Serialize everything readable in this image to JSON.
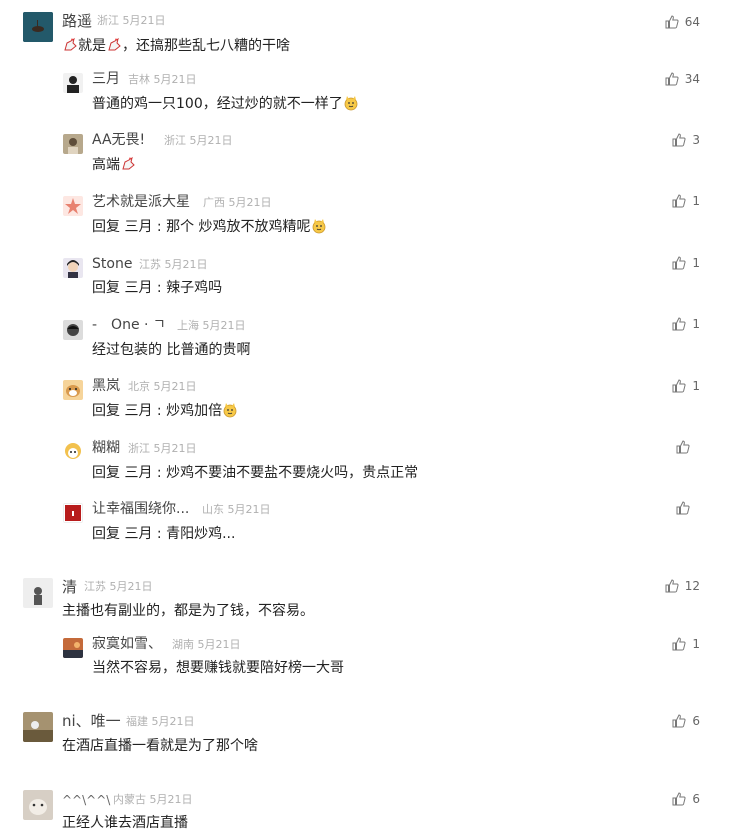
{
  "thread": [
    {
      "user": "路遥",
      "location": "浙江",
      "date": "5月21日",
      "likes": "64",
      "avatar_color": "#1f4e5a",
      "text_parts": [
        "",
        "就是",
        "，还搞那些乱七八糟的干啥"
      ],
      "emoji": [
        "rooster-emoji",
        "rooster-emoji"
      ]
    },
    {
      "user": "三月",
      "location": "吉林",
      "date": "5月21日",
      "likes": "34",
      "avatar_color": "#2b2b2b",
      "text": "普通的鸡一只100，经过炒的就不一样了",
      "emoji_after": "cat-emoji"
    },
    {
      "user": "AA无畏!",
      "location": "浙江",
      "date": "5月21日",
      "likes": "3",
      "avatar_color": "#8d7a60",
      "text": "高端",
      "emoji_after": "rooster-emoji"
    },
    {
      "user": "艺术就是派大星",
      "location": "广西",
      "date": "5月21日",
      "likes": "1",
      "avatar_color": "#e8816f",
      "reply_prefix": "回复 三月 :",
      "text": " 那个 炒鸡放不放鸡精呢",
      "emoji_after": "cat-emoji"
    },
    {
      "user": "Stone",
      "location": "江苏",
      "date": "5月21日",
      "likes": "1",
      "avatar_color": "#333344",
      "reply_prefix": "回复 三月 :",
      "text": " 辣子鸡吗"
    },
    {
      "user": "-　One · ㄱ",
      "location": "上海",
      "date": "5月21日",
      "likes": "1",
      "avatar_color": "#5a5a5a",
      "text": "经过包装的 比普通的贵啊"
    },
    {
      "user": "黑岚",
      "location": "北京",
      "date": "5月21日",
      "likes": "1",
      "avatar_color": "#d99a4e",
      "reply_prefix": "回复 三月 :",
      "text": " 炒鸡加倍",
      "emoji_after": "cat-emoji"
    },
    {
      "user": "糊糊",
      "location": "浙江",
      "date": "5月21日",
      "likes": "",
      "avatar_color": "#e0b84a",
      "reply_prefix": "回复 三月 :",
      "text": " 炒鸡不要油不要盐不要烧火吗，贵点正常"
    },
    {
      "user": "让幸福围绕你...",
      "location": "山东",
      "date": "5月21日",
      "likes": "",
      "avatar_color": "#b81c1c",
      "reply_prefix": "回复 三月 :",
      "text": " 青阳炒鸡..."
    },
    {
      "user": "清",
      "location": "江苏",
      "date": "5月21日",
      "likes": "12",
      "avatar_color": "#9a9a9a",
      "text": "主播也有副业的，都是为了钱，不容易。"
    },
    {
      "user": "寂寞如雪、",
      "location": "湖南",
      "date": "5月21日",
      "likes": "1",
      "avatar_color": "#c46a3a",
      "text": "当然不容易，想要赚钱就要陪好榜一大哥"
    },
    {
      "user": "ni、唯一",
      "location": "福建",
      "date": "5月21日",
      "likes": "6",
      "avatar_color": "#7d6c4a",
      "text": "在酒店直播一看就是为了那个啥"
    },
    {
      "user": "^^\\^^\\",
      "location": "内蒙古",
      "date": "5月21日",
      "likes": "6",
      "avatar_color": "#c9c0b5",
      "text": "正经人谁去酒店直播"
    }
  ]
}
